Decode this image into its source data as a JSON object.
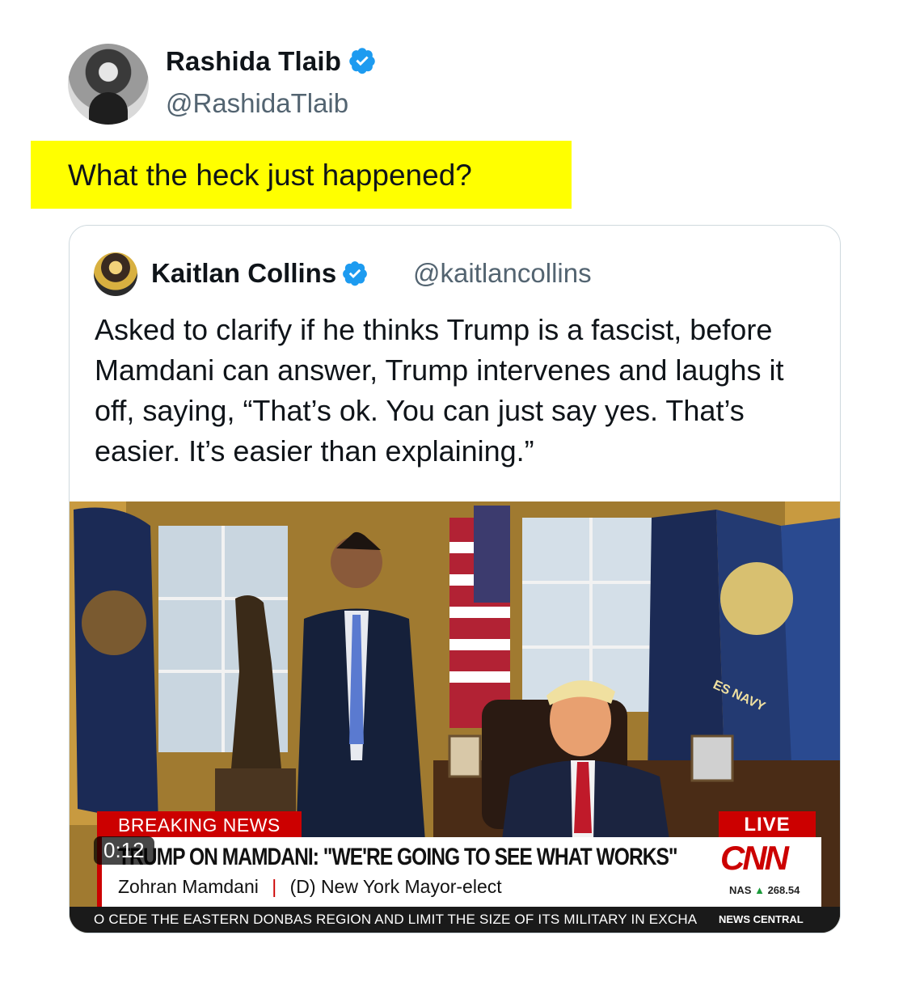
{
  "tweet": {
    "author_name": "Rashida Tlaib",
    "author_handle": "@RashidaTlaib",
    "text": "What the heck just happened?",
    "highlight_color": "#ffff00"
  },
  "quote": {
    "author_name": "Kaitlan Collins",
    "author_handle": "@kaitlancollins",
    "text": "Asked to clarify if he thinks Trump is a fascist, before Mamdani can answer, Trump intervenes and laughs it off, saying, “That’s ok. You can just say yes. That’s easier. It’s easier than explaining.”",
    "video": {
      "duration": "0:12",
      "breaking_label": "BREAKING NEWS",
      "live_label": "LIVE",
      "headline": "TRUMP ON MAMDANI: \"WE'RE GOING TO SEE WHAT WORKS\"",
      "lower_third_name": "Zohran Mamdani",
      "lower_third_sep": "|",
      "lower_third_title": "(D) New York Mayor-elect",
      "network": "CNN",
      "ticker_symbol": "NAS",
      "ticker_value": "268.54",
      "crawl_text": "O CEDE THE EASTERN DONBAS REGION AND LIMIT THE SIZE OF ITS MILITARY IN EXCHA",
      "crawl_brand": "NEWS CENTRAL",
      "flag_text": "ES NAVY",
      "colors": {
        "cnn_red": "#cc0000",
        "verified_blue": "#1d9bf0"
      }
    }
  },
  "icons": {
    "verified": "verified-badge-icon"
  }
}
